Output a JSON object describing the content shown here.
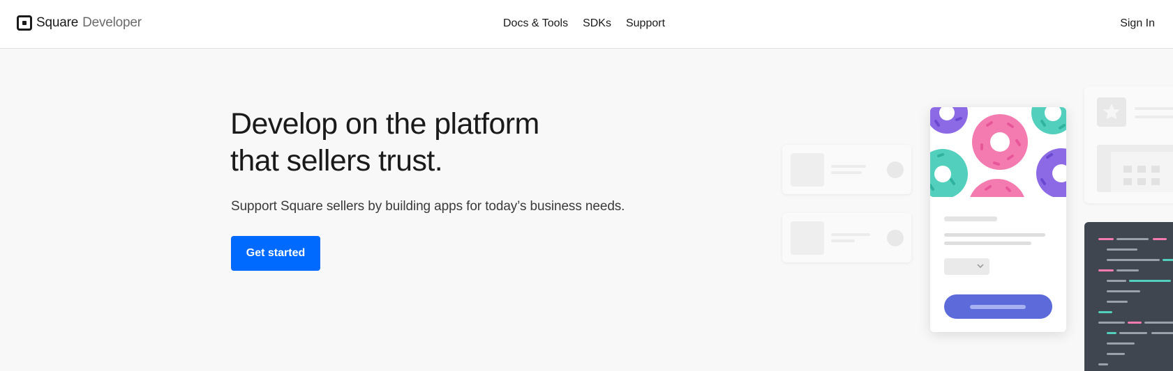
{
  "header": {
    "brand_name": "Square",
    "brand_sub": "Developer",
    "nav": [
      "Docs & Tools",
      "SDKs",
      "Support"
    ],
    "signin_label": "Sign In"
  },
  "hero": {
    "title_line1": "Develop on the platform",
    "title_line2": "that sellers trust.",
    "subtitle": "Support Square sellers by building apps for today’s business needs.",
    "cta_label": "Get started"
  },
  "colors": {
    "accent": "#006aff",
    "card_button": "#5c6bd9",
    "donut_purple": "#8c6ae6",
    "donut_pink": "#f47bb0",
    "donut_teal": "#52d0bd",
    "code_bg": "#3f4650"
  }
}
